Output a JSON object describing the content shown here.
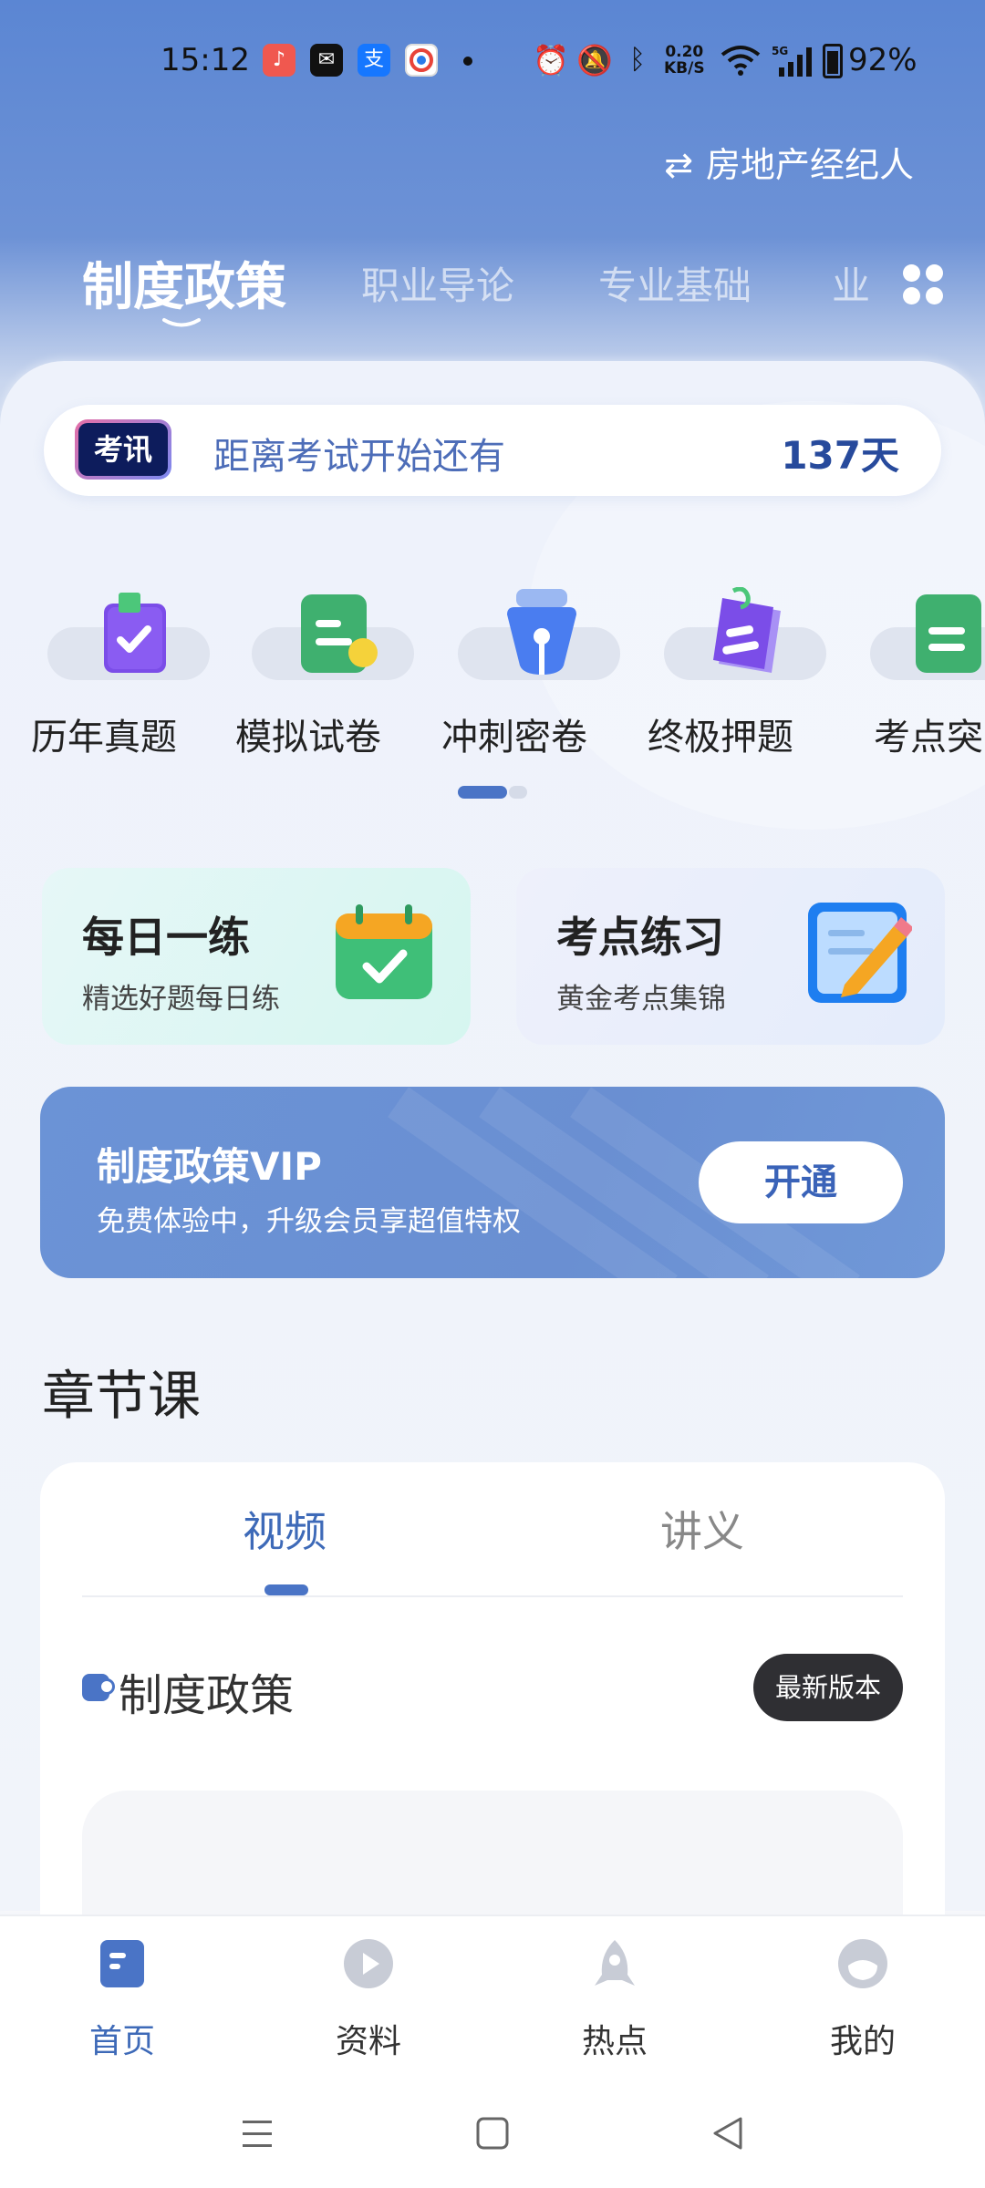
{
  "status_bar": {
    "time": "15:12",
    "net_speed_value": "0.20",
    "net_speed_unit": "KB/S",
    "battery": "92%",
    "icons": [
      "music-app-icon",
      "mail-icon",
      "alipay-icon",
      "browser-app-icon",
      "alarm-icon",
      "mute-icon",
      "bluetooth-icon",
      "wifi-icon",
      "signal-5g-icon",
      "battery-icon"
    ]
  },
  "header": {
    "exam_switch_label": "房地产经纪人",
    "tabs": [
      {
        "label": "制度政策",
        "active": true
      },
      {
        "label": "职业导论",
        "active": false
      },
      {
        "label": "专业基础",
        "active": false
      },
      {
        "label": "业",
        "active": false
      }
    ]
  },
  "countdown": {
    "badge": "考讯",
    "label": "距离考试开始还有",
    "days": "137天"
  },
  "quick_actions": [
    {
      "label": "历年真题",
      "icon": "past-papers-icon"
    },
    {
      "label": "模拟试卷",
      "icon": "mock-paper-icon"
    },
    {
      "label": "冲刺密卷",
      "icon": "sprint-paper-icon"
    },
    {
      "label": "终极押题",
      "icon": "final-prediction-icon"
    },
    {
      "label": "考点突",
      "icon": "key-points-icon"
    }
  ],
  "practice_cards": [
    {
      "title": "每日一练",
      "subtitle": "精选好题每日练",
      "icon": "calendar-check-icon"
    },
    {
      "title": "考点练习",
      "subtitle": "黄金考点集锦",
      "icon": "notepad-pencil-icon"
    }
  ],
  "vip": {
    "title": "制度政策VIP",
    "subtitle": "免费体验中，升级会员享超值特权",
    "button": "开通"
  },
  "chapter": {
    "title": "章节课",
    "tabs": [
      {
        "label": "视频",
        "active": true
      },
      {
        "label": "讲义",
        "active": false
      }
    ],
    "section_title": "制度政策",
    "version_badge": "最新版本"
  },
  "bottom_nav": [
    {
      "label": "首页",
      "icon": "home-icon",
      "active": true
    },
    {
      "label": "资料",
      "icon": "play-circle-icon",
      "active": false
    },
    {
      "label": "热点",
      "icon": "rocket-icon",
      "active": false
    },
    {
      "label": "我的",
      "icon": "profile-icon",
      "active": false
    }
  ],
  "colors": {
    "accent": "#4a74c6",
    "header_gradient_top": "#5b86d3",
    "countdown_days": "#274a9c",
    "vip_background": "#6b93d6"
  }
}
